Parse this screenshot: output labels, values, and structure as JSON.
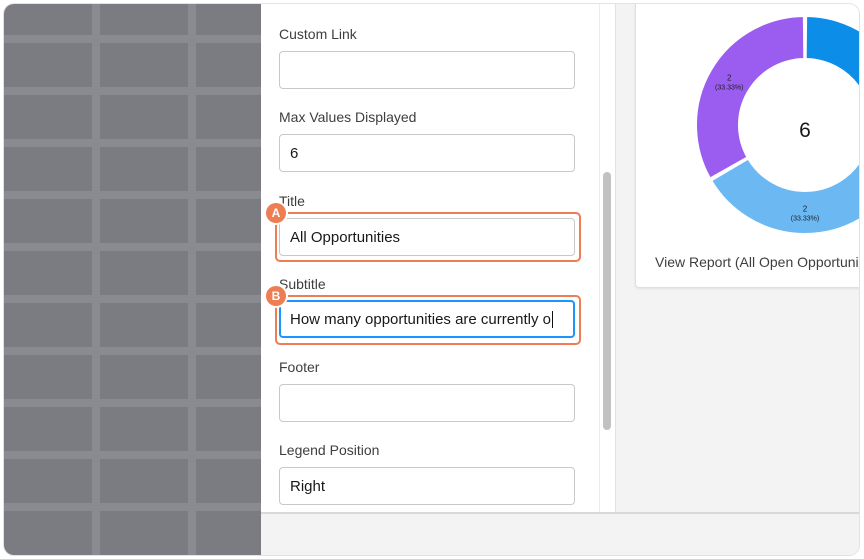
{
  "properties": {
    "custom_link": {
      "label": "Custom Link",
      "value": ""
    },
    "max_values": {
      "label": "Max Values Displayed",
      "value": "6"
    },
    "title": {
      "label": "Title",
      "value": "All Opportunities",
      "marker": "A"
    },
    "subtitle": {
      "label": "Subtitle",
      "value": "How many opportunities are currently o",
      "marker": "B"
    },
    "footer": {
      "label": "Footer",
      "value": ""
    },
    "legend_position": {
      "label": "Legend Position",
      "value": "Right"
    }
  },
  "colors": {
    "highlight": "#ed7d52",
    "focus": "#1b96ff",
    "segment_purple": "#9b5cf0",
    "segment_lightblue": "#6cb8f3",
    "segment_blue": "#0c8ee8"
  },
  "preview": {
    "center_total": "6",
    "view_report": "View Report (All Open Opportuni",
    "chart_data": {
      "type": "pie",
      "segments": [
        {
          "value": 2,
          "label": "2",
          "percent": "(33.33%)",
          "color": "#9b5cf0"
        },
        {
          "value": 2,
          "label": "2",
          "percent": "(33.33%)",
          "color": "#6cb8f3"
        },
        {
          "value": 2,
          "label": "",
          "percent": "",
          "color": "#0c8ee8"
        }
      ]
    }
  }
}
